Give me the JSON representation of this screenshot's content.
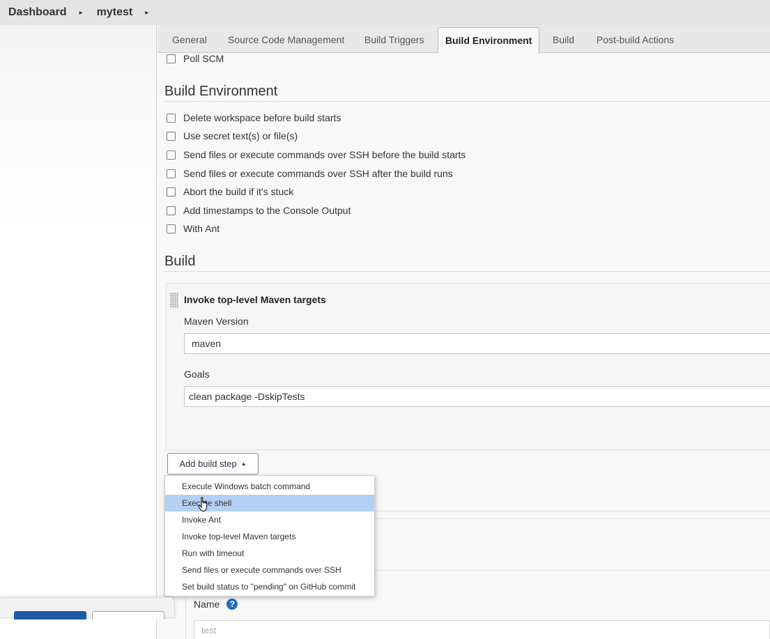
{
  "breadcrumb": {
    "items": [
      "Dashboard",
      "mytest"
    ],
    "separator": "▸"
  },
  "tabs": [
    "General",
    "Source Code Management",
    "Build Triggers",
    "Build Environment",
    "Build",
    "Post-build Actions"
  ],
  "active_tab": "Build Environment",
  "triggers": {
    "poll_scm": "Poll SCM"
  },
  "build_environment": {
    "title": "Build Environment",
    "options": [
      "Delete workspace before build starts",
      "Use secret text(s) or file(s)",
      "Send files or execute commands over SSH before the build starts",
      "Send files or execute commands over SSH after the build runs",
      "Abort the build if it's stuck",
      "Add timestamps to the Console Output",
      "With Ant"
    ]
  },
  "build": {
    "title": "Build",
    "step": {
      "title": "Invoke top-level Maven targets",
      "maven_version_label": "Maven Version",
      "maven_version_value": "maven",
      "goals_label": "Goals",
      "goals_value": "clean package -DskipTests"
    },
    "add_step_label": "Add build step",
    "menu": [
      "Execute Windows batch command",
      "Execute shell",
      "Invoke Ant",
      "Invoke top-level Maven targets",
      "Run with timeout",
      "Send files or execute commands over SSH",
      "Set build status to \"pending\" on GitHub commit"
    ],
    "highlighted_menu_item": "Execute shell"
  },
  "name_field": {
    "label": "Name",
    "help": "?",
    "value": "test"
  },
  "colors": {
    "accent": "#1d5aa8",
    "menu_highlight": "#b3d1f5",
    "help_icon": "#1f6fbf"
  },
  "icons": {
    "breadcrumb_separator": "chevron-right-icon",
    "dropdown_caret": "caret-up-icon",
    "help": "help-icon",
    "cursor": "hand-pointer-icon"
  }
}
